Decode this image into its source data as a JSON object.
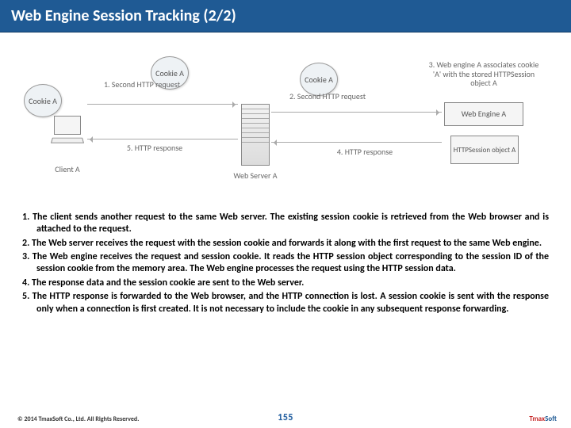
{
  "header": {
    "title": "Web Engine Session Tracking (2/2)"
  },
  "diagram": {
    "bubble1": "Cookie A",
    "bubble2": "Cookie A",
    "bubble3": "Cookie A",
    "label1": "1. Second HTTP request",
    "label2": "2. Second HTTP request",
    "label3": "3. Web engine A associates cookie 'A' with the stored HTTPSession object A",
    "label4": "4. HTTP response",
    "label5": "5. HTTP response",
    "client": "Client A",
    "server": "Web Server A",
    "engine": "Web Engine A",
    "session": "HTTPSession object A"
  },
  "steps": {
    "s1": "1. The client sends another request to the same Web server. The existing session cookie is retrieved from the Web browser and is attached to the request.",
    "s2": "2. The Web server receives the request with the session cookie and forwards it along with the first request to the same Web engine.",
    "s3": "3. The Web engine receives the request and session cookie. It reads the HTTP session object corresponding to the session ID of the session cookie from the memory area. The Web engine processes the request using the HTTP session data.",
    "s4": "4. The response data and the session cookie are sent to the Web server.",
    "s5": "5. The HTTP response is forwarded to the Web browser, and the HTTP connection is lost. A session cookie is sent with the response only when a connection is first created. It is not necessary to include the cookie in any subsequent response forwarding."
  },
  "footer": {
    "copyright": "© 2014 TmaxSoft Co., Ltd. All Rights Reserved.",
    "page": "155",
    "logo_a": "Tmax",
    "logo_b": "Soft"
  }
}
